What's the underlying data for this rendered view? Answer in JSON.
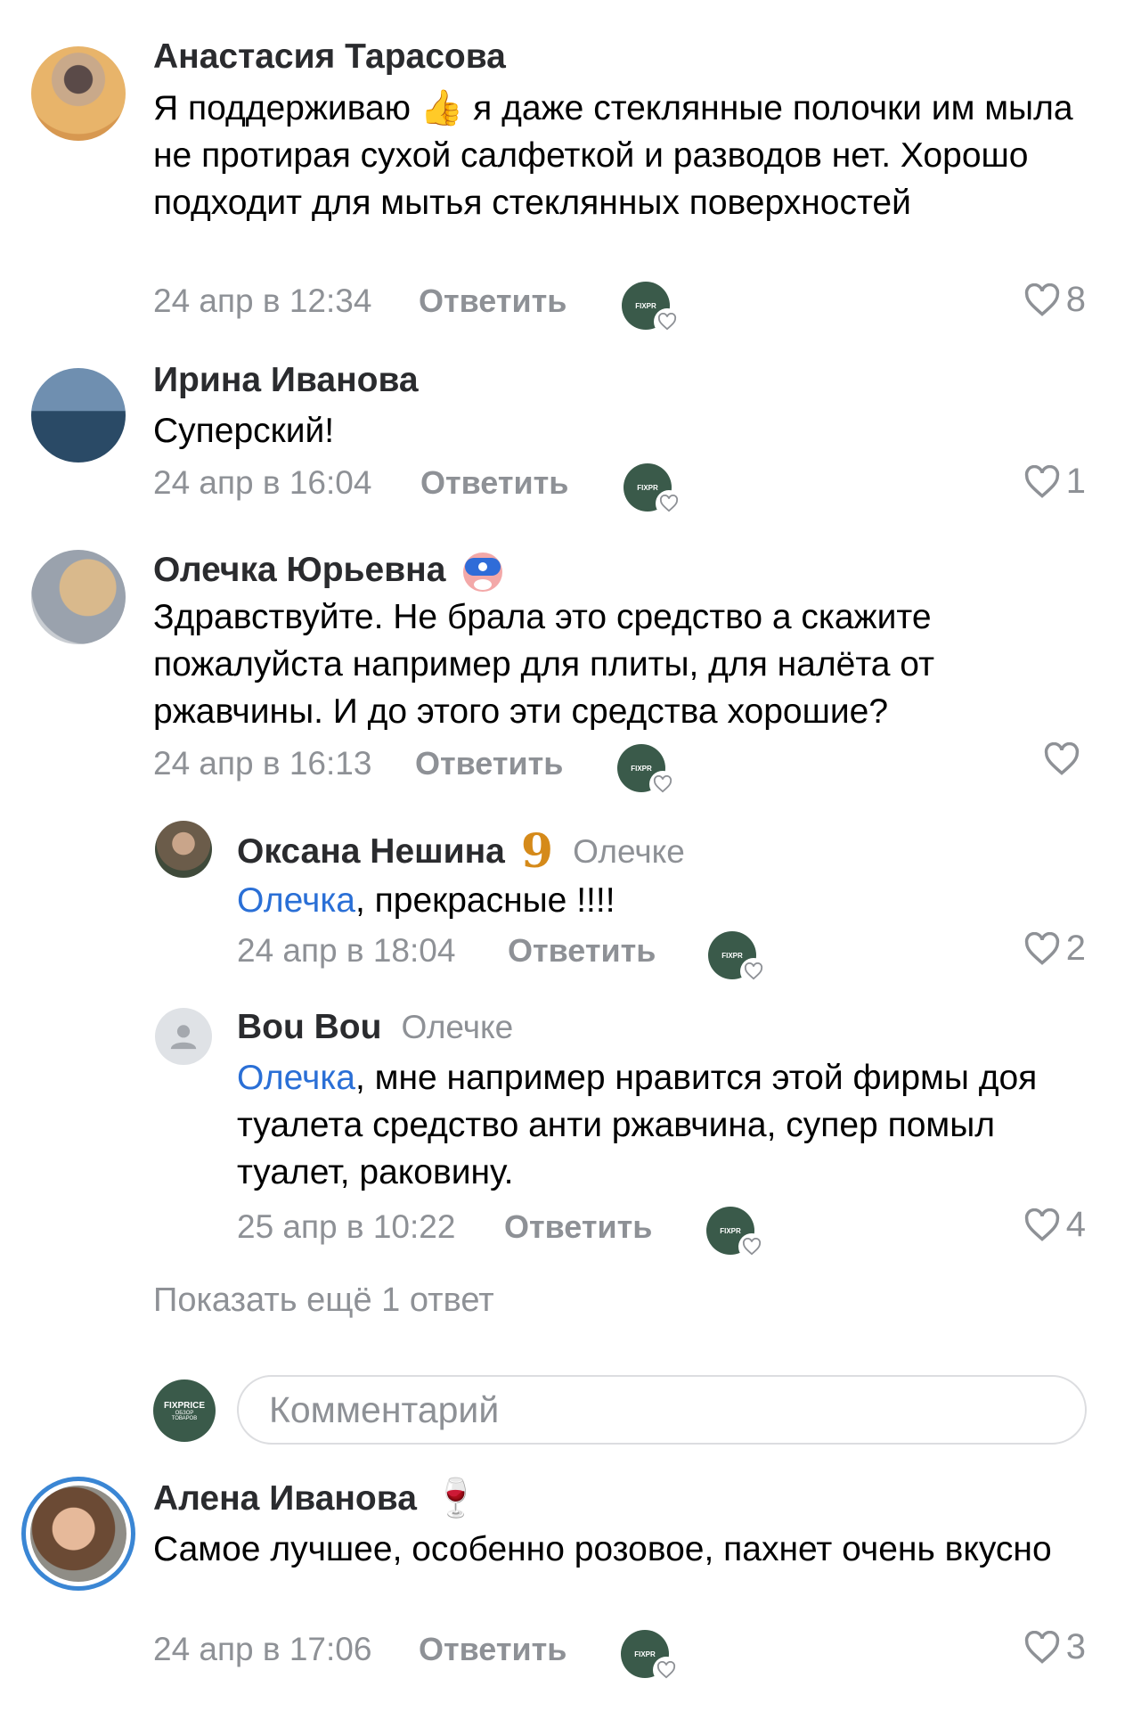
{
  "comments": [
    {
      "author": "Анастасия Тарасова",
      "text_before": "Я поддерживаю ",
      "emoji": "👍",
      "text_after": " я даже стеклянные полочки им мыла не протирая сухой салфеткой и разводов нет. Хорошо подходит для мытья стеклянных поверхностей",
      "time": "24 апр в 12:34",
      "reply_label": "Ответить",
      "likes": "8"
    },
    {
      "author": "Ирина Иванова",
      "text": "Суперский!",
      "time": "24 апр в 16:04",
      "reply_label": "Ответить",
      "likes": "1"
    },
    {
      "author": "Олечка Юрьевна",
      "text": "Здравствуйте. Не брала это средство а скажите пожалуйста например для плиты, для налёта от ржавчины. И до этого эти средства хорошие?",
      "time": "24 апр в 16:13",
      "reply_label": "Ответить",
      "likes": ""
    },
    {
      "author": "Оксана Нешина",
      "badge": "9",
      "addressee": "Олечке",
      "mention": "Олечка",
      "text": ", прекрасные !!!!",
      "time": "24 апр в 18:04",
      "reply_label": "Ответить",
      "likes": "2"
    },
    {
      "author": "Bou Bou",
      "addressee": "Олечке",
      "mention": "Олечка",
      "text": ", мне например нравится этой фирмы доя туалета средство анти ржавчина, супер помыл туалет, раковину.",
      "time": "25 апр в 10:22",
      "reply_label": "Ответить",
      "likes": "4"
    },
    {
      "author": "Алена Иванова",
      "emoji": "🍷",
      "text": "Самое лучшее, особенно розовое, пахнет очень вкусно",
      "time": "24 апр в 17:06",
      "reply_label": "Ответить",
      "likes": "3"
    }
  ],
  "show_more": "Показать ещё 1 ответ",
  "comment_input": {
    "placeholder": "Комментарий"
  },
  "reactor_label": "FIXPR",
  "composer_avatar": {
    "brand": "FIXPRICE",
    "caption": "ОБЗОР ТОВАРОВ"
  },
  "colors": {
    "accent": "#2a6fd6",
    "muted": "#8e9196",
    "avatar_green": "#3a5a4a"
  }
}
